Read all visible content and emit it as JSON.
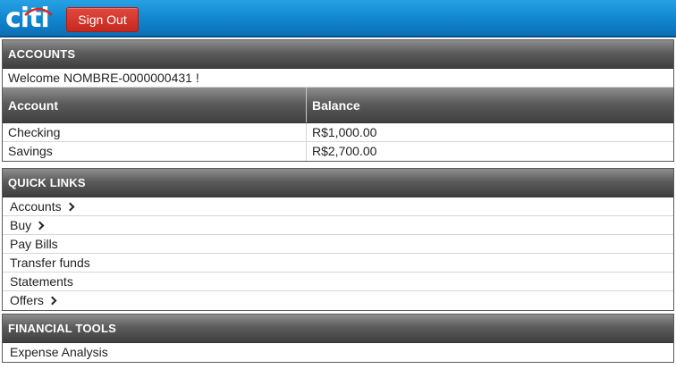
{
  "header": {
    "logo_text": "citi",
    "signout_label": "Sign Out"
  },
  "accounts": {
    "title": "ACCOUNTS",
    "welcome": "Welcome NOMBRE-0000000431 !",
    "columns": [
      "Account",
      "Balance"
    ],
    "rows": [
      {
        "account": "Checking",
        "balance": "R$1,000.00"
      },
      {
        "account": "Savings",
        "balance": "R$2,700.00"
      }
    ]
  },
  "quick_links": {
    "title": "QUICK LINKS",
    "items": [
      {
        "label": "Accounts",
        "chevron": true
      },
      {
        "label": "Buy",
        "chevron": true
      },
      {
        "label": "Pay Bills",
        "chevron": false
      },
      {
        "label": "Transfer funds",
        "chevron": false
      },
      {
        "label": "Statements",
        "chevron": false
      },
      {
        "label": "Offers",
        "chevron": true
      }
    ]
  },
  "financial_tools": {
    "title": "FINANCIAL TOOLS",
    "items": [
      {
        "label": "Expense Analysis"
      }
    ]
  },
  "colors": {
    "header_blue": "#1185cf",
    "signout_red": "#c6281f",
    "panel_header_gray": "#5c5c5c"
  },
  "icons": {
    "chevron": "chevron-right-icon",
    "logo": "citi-logo"
  }
}
